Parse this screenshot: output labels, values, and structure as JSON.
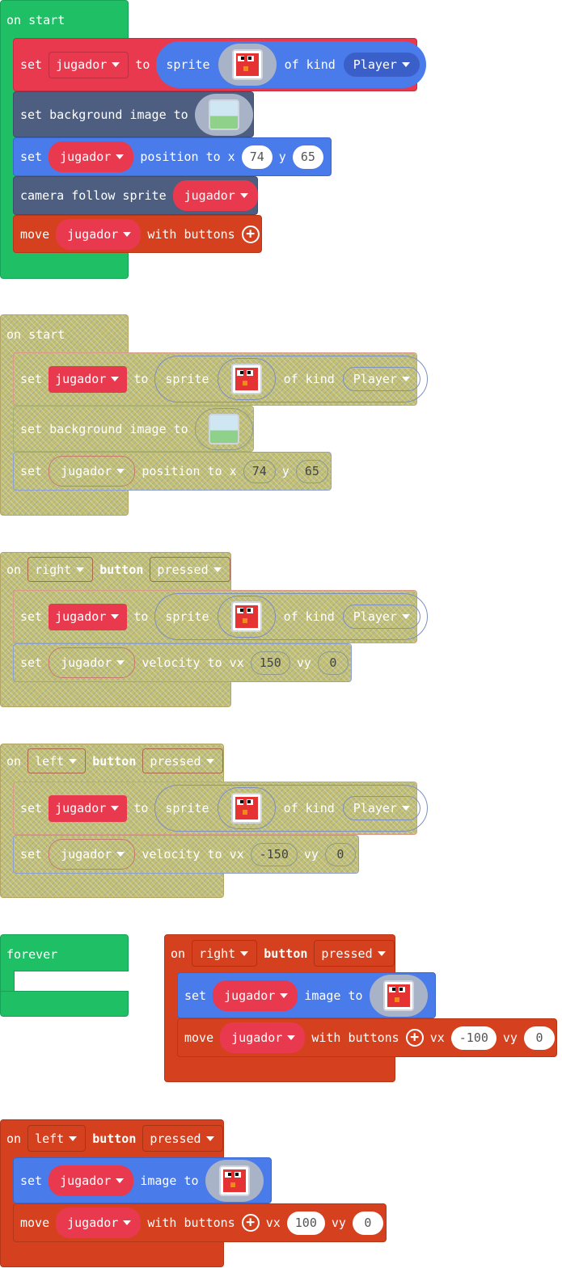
{
  "var": "jugador",
  "kw": {
    "on_start": "on start",
    "set": "set",
    "to": "to",
    "sprite": "sprite",
    "of_kind": "of kind",
    "set_bg": "set background image to",
    "position_to_x": "position to x",
    "y": "y",
    "camera_follow": "camera follow sprite",
    "move": "move",
    "with_buttons": "with buttons",
    "on": "on",
    "button": "button",
    "velocity_to_vx": "velocity to vx",
    "vy": "vy",
    "vx": "vx",
    "forever": "forever",
    "image_to": "image to"
  },
  "values": {
    "kind": "Player",
    "x": "74",
    "y": "65",
    "right": "right",
    "left": "left",
    "pressed": "pressed",
    "vx_150": "150",
    "vx_neg150": "-150",
    "vy_0": "0",
    "vx_neg100": "-100",
    "vx_100": "100"
  },
  "colors": {
    "events": "#1fbf65",
    "sprites": "#e8394f",
    "scene": "#4d5e80",
    "sprite_set": "#4a7bea",
    "controller": "#d5411f",
    "disabled": "#c2bf73"
  },
  "icons": [
    "sprite-image-icon",
    "background-image-icon",
    "caret-down-icon",
    "plus-icon"
  ]
}
